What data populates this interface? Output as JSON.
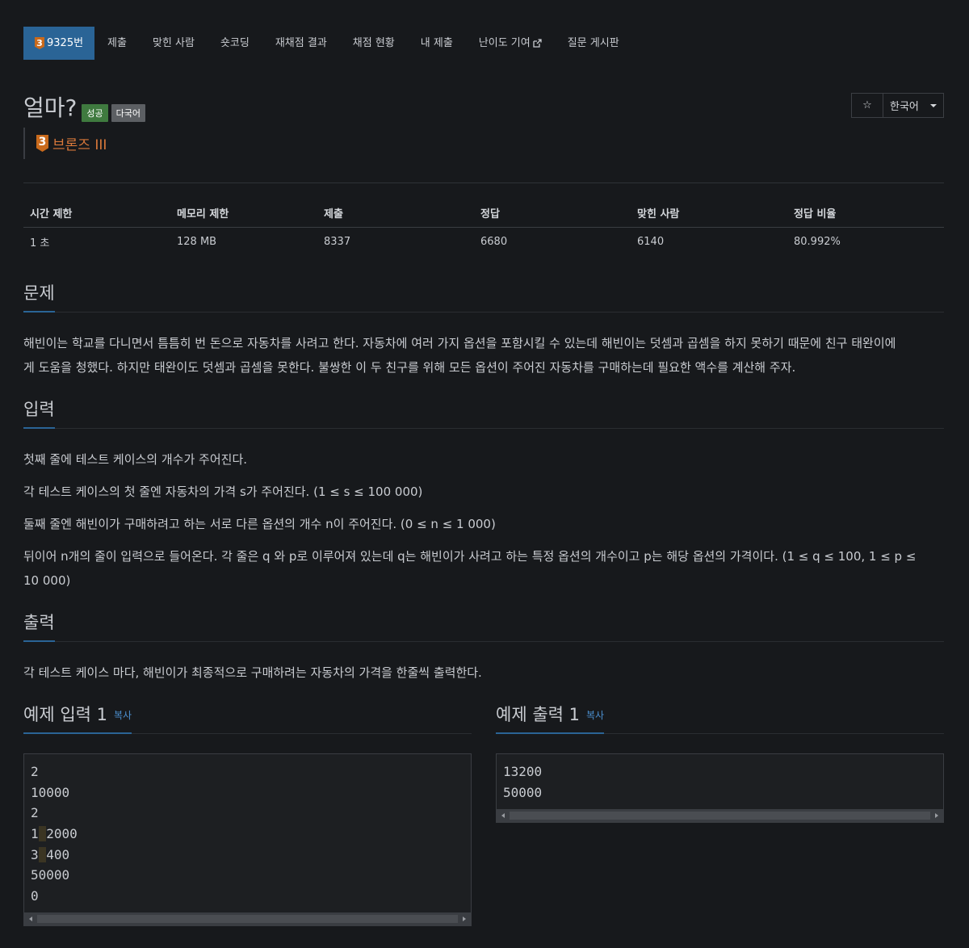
{
  "nav": {
    "problem_tier": "3",
    "problem_id": "9325번",
    "tabs": [
      "제출",
      "맞힌 사람",
      "숏코딩",
      "재채점 결과",
      "채점 현황",
      "내 제출",
      "난이도 기여",
      "질문 게시판"
    ]
  },
  "problem": {
    "title": "얼마?",
    "labels": {
      "success": "성공",
      "multilang": "다국어"
    },
    "tier_level": "3",
    "tier_name": "브론즈 III",
    "language": "한국어",
    "star_glyph": "☆"
  },
  "stats": {
    "headers": [
      "시간 제한",
      "메모리 제한",
      "제출",
      "정답",
      "맞힌 사람",
      "정답 비율"
    ],
    "values": [
      "1 초",
      "128 MB",
      "8337",
      "6680",
      "6140",
      "80.992%"
    ]
  },
  "sections": {
    "description": {
      "title": "문제",
      "lines": [
        "해빈이는 학교를 다니면서 틈틈히 번 돈으로 자동차를 사려고 한다. 자동차에 여러 가지 옵션을 포함시킬 수 있는데 해빈이는 덧셈과 곱셈을 하지 못하기 때문에 친구 태완이에",
        "게 도움을 청했다. 하지만 태완이도 덧셈과 곱셈을 못한다. 불쌍한 이 두 친구를 위해 모든 옵션이 주어진 자동차를 구매하는데 필요한 액수를 계산해 주자."
      ]
    },
    "input": {
      "title": "입력",
      "p1": "첫째 줄에 테스트 케이스의 개수가 주어진다.",
      "p2": "각 테스트 케이스의 첫 줄엔 자동차의 가격 s가 주어진다. (1 ≤ s ≤ 100 000)",
      "p3": "둘째 줄엔 해빈이가 구매하려고 하는 서로 다른 옵션의 개수 n이 주어진다. (0 ≤ n ≤ 1 000)",
      "p4_line1": "뒤이어 n개의 줄이 입력으로 들어온다. 각 줄은 q 와 p로 이루어져 있는데 q는 해빈이가 사려고 하는 특정 옵션의 개수이고 p는 해당 옵션의 가격이다. (1 ≤ q ≤ 100, 1 ≤ p ≤",
      "p4_line2": "10 000)"
    },
    "output": {
      "title": "출력",
      "p1": "각 테스트 케이스 마다, 해빈이가 최종적으로 구매하려는 자동차의 가격을 한줄씩 출력한다."
    },
    "sample_input": {
      "title": "예제 입력 1",
      "copy": "복사",
      "lines": [
        "2",
        "10000",
        "2",
        "1",
        "2000",
        "3",
        "400",
        "50000",
        "0"
      ]
    },
    "sample_output": {
      "title": "예제 출력 1",
      "copy": "복사",
      "lines": [
        "13200",
        "50000"
      ]
    }
  }
}
